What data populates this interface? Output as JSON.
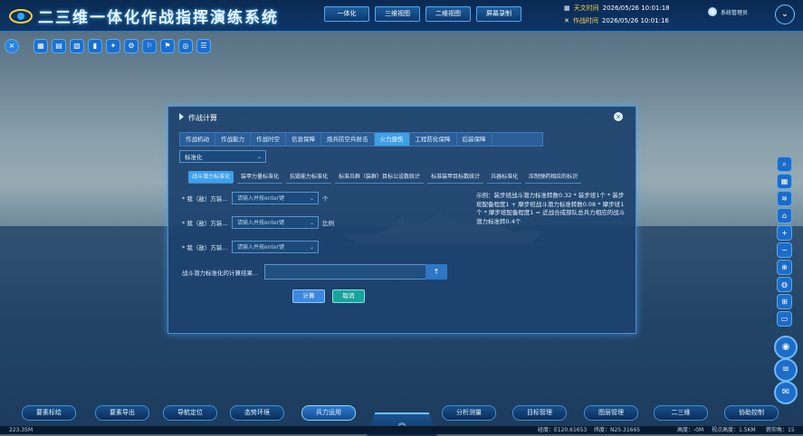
{
  "header": {
    "title": "二三维一体化作战指挥演练系统",
    "nav_buttons": [
      "一体化",
      "三维视图",
      "二维视图",
      "屏幕录制"
    ],
    "astro_time_label": "天文时间",
    "astro_time_value": "2026/05/26 10:01:18",
    "combat_time_label": "作战时间",
    "combat_time_value": "2026/05/26 10:01:16",
    "user_name": "系统管理员",
    "user_chevron": "⌄"
  },
  "toolbar": {
    "close_icon": "×",
    "icons": [
      "▦",
      "▤",
      "▧",
      "▮",
      "✦",
      "⚙",
      "⚐",
      "⚑",
      "◎",
      "☰"
    ]
  },
  "dialog": {
    "title": "作战计算",
    "close_icon": "×",
    "tabs": [
      "作战机动",
      "作战能力",
      "作战时空",
      "信息保障",
      "炮兵防空兵射击",
      "火力毁伤",
      "工程防化保障",
      "后装保障"
    ],
    "active_tab": 5,
    "select_value": "标准化",
    "select_chevron": "⌄",
    "subtabs": [
      "战斗潜力标准化",
      "装甲力量标准化",
      "抗毁能力标准化",
      "标准兵群（装群）目标公设数统计",
      "标准装甲目标数统计",
      "兵器标准化",
      "压制弹药相应的标识"
    ],
    "active_subtab": 0,
    "fields": [
      {
        "label": "* 我（敌）方装...",
        "placeholder": "请输入并按enter键",
        "suffix": "个"
      },
      {
        "label": "* 我（敌）方装...",
        "placeholder": "请输入并按enter键",
        "suffix": "比例"
      },
      {
        "label": "* 我（敌）方装...",
        "placeholder": "请输入并按enter键",
        "suffix": ""
      }
    ],
    "example_text": "示例：装步班战斗潜力标准转数0.32 * 装步班1个 * 装步班配备程度1 + 摩步班战斗潜力标准转数0.08 * 摩步班1个 * 摩步班配备程度1 = 近战合成部队总兵力相应的战斗潜力标准转0.4个",
    "result_label": "战斗潜力标准化的计算结果...",
    "result_icon": "↑",
    "calc_button": "计算",
    "cancel_button": "取消"
  },
  "right_tools": [
    "⌕",
    "▦",
    "≋",
    "⌂",
    "+",
    "−",
    "⊕",
    "◍",
    "⊞",
    "▭"
  ],
  "right_round": [
    "◉",
    "≡",
    "✉"
  ],
  "bottom_nav": [
    "要素标绘",
    "要素导出",
    "导航定位",
    "态势环境",
    "兵力运用",
    "分析测量",
    "目标管理",
    "图层管理",
    "二三维",
    "协助控制"
  ],
  "bottom_active": 4,
  "bottom_center_icon": "︽",
  "status": {
    "scale": "223.35M",
    "lon": "经度：E120.61653",
    "lat": "纬度：N25.31665",
    "alt": "高度：-0M",
    "view_alt": "视点高度：1.5KM",
    "heading": "俯仰角：15"
  }
}
